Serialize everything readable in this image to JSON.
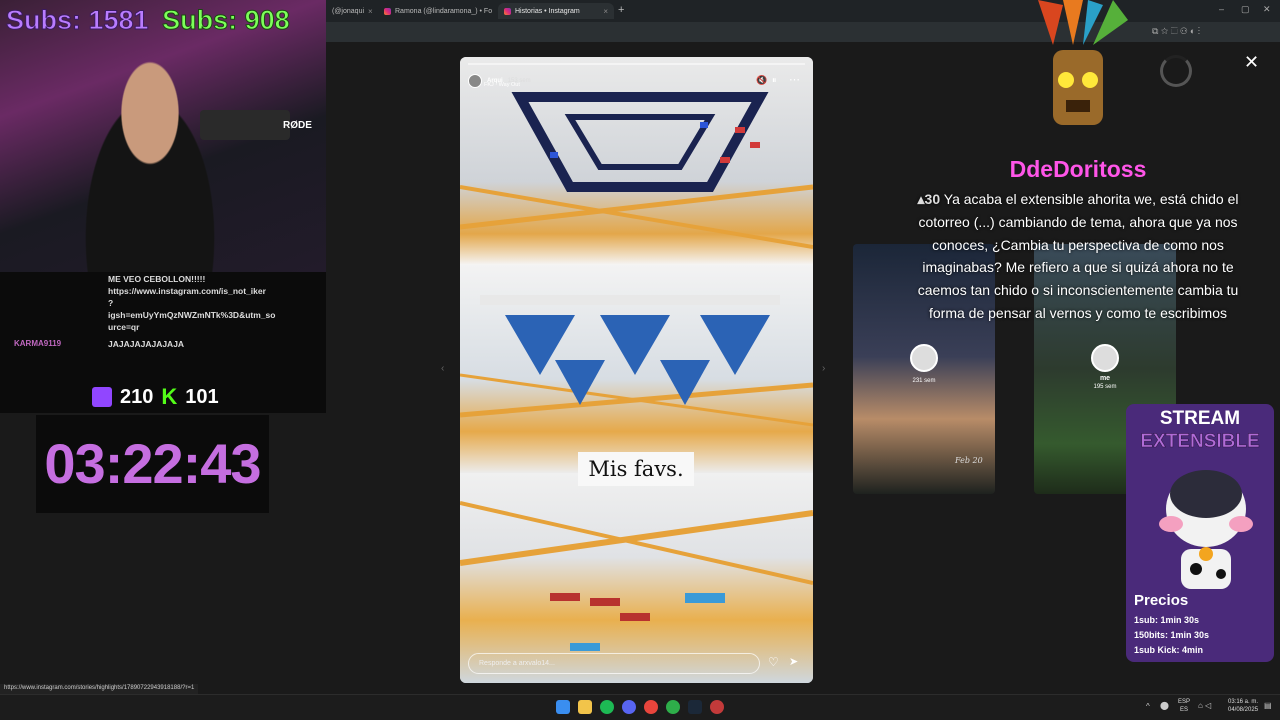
{
  "browser": {
    "tabs": [
      {
        "label": "(@jonaqui"
      },
      {
        "label": "Ramona (@lindaramona_) • Fo"
      },
      {
        "label": "Historias • Instagram"
      }
    ],
    "new_tab": "+",
    "close_tab": "×",
    "status_url": "https://www.instagram.com/stories/highlights/17890722943918188/?r=1"
  },
  "stream": {
    "subs_twitch": "Subs: 1581",
    "subs_kick": "Subs: 908",
    "viewers_twitch": "210",
    "viewers_kick": "101",
    "timer": "03:22:43",
    "colors": {
      "twitch": "#9146ff",
      "kick": "#53fc18",
      "timer": "#c56ee0",
      "donor": "#ff55e8"
    }
  },
  "chat": [
    {
      "user": "",
      "text": "ME VEO CEBOLLON!!!!!"
    },
    {
      "user": "",
      "text": "https://www.instagram.com/is_not_iker"
    },
    {
      "user": "",
      "text": "?"
    },
    {
      "user": "",
      "text": "igsh=emUyYmQzNWZmNTk%3D&utm_so"
    },
    {
      "user": "",
      "text": "urce=qr"
    },
    {
      "user": "KARMA9119",
      "text": "JAJAJAJAJAJAJA"
    }
  ],
  "story": {
    "username": "Arqui",
    "time": "153 sem",
    "song": "FKJ · Way Out",
    "caption": "Mis favs.",
    "reply_placeholder": "Responde a arxvalo14..."
  },
  "side_cards": [
    {
      "name": "",
      "time": "231 sem",
      "date": "Feb 20"
    },
    {
      "name": "me",
      "time": "195 sem"
    }
  ],
  "donation": {
    "name": "DdeDoritoss",
    "amount": "30",
    "message": "Ya acaba el extensible ahorita we, está chido el cotorreo (...) cambiando de tema, ahora que ya nos conoces, ¿Cambia tu perspectiva de como nos imaginabas? Me refiero a que si quizá ahora no te caemos tan chido o si inconscientemente cambia tu forma de pensar al vernos y como te escribimos"
  },
  "promo": {
    "title1": "STREAM",
    "title2": "EXTENSIBLE",
    "prices_title": "Precios",
    "prices": [
      "1sub: 1min 30s",
      "150bits: 1min 30s",
      "1sub Kick: 4min"
    ]
  },
  "taskbar": {
    "lang": "ESP",
    "lang2": "ES",
    "time": "03:16 a. m.",
    "date": "04/08/2025"
  }
}
